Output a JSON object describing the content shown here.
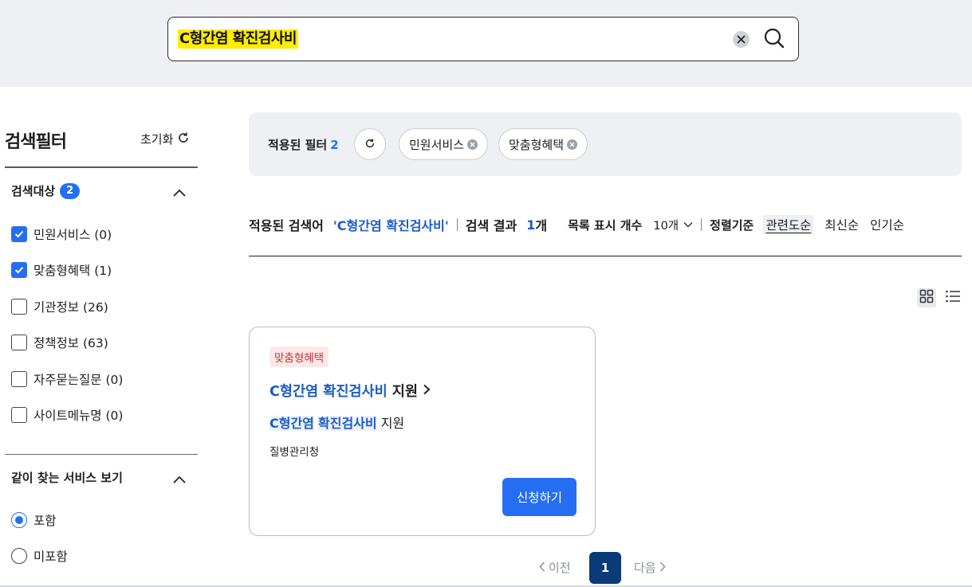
{
  "search": {
    "value": "C형간염 확진검사비"
  },
  "sidebar": {
    "title": "검색필터",
    "reset_label": "초기화",
    "section_target": {
      "title": "검색대상",
      "badge": "2",
      "items": [
        {
          "label": "민원서비스 (0)",
          "checked": true
        },
        {
          "label": "맞춤형혜택 (1)",
          "checked": true
        },
        {
          "label": "기관정보 (26)",
          "checked": false
        },
        {
          "label": "정책정보 (63)",
          "checked": false
        },
        {
          "label": "자주묻는질문 (0)",
          "checked": false
        },
        {
          "label": "사이트메뉴명 (0)",
          "checked": false
        }
      ]
    },
    "section_related": {
      "title": "같이 찾는 서비스 보기",
      "options": [
        {
          "label": "포함",
          "selected": true
        },
        {
          "label": "미포함",
          "selected": false
        }
      ]
    }
  },
  "applied_filters": {
    "label": "적용된 필터",
    "count": "2",
    "chips": [
      "민원서비스",
      "맞춤형혜택"
    ]
  },
  "result_bar": {
    "query_label": "적용된 검색어",
    "query_value": "'C형간염 확진검사비'",
    "result_label": "검색 결과",
    "result_count": "1",
    "result_unit": "개",
    "page_size_label": "목록 표시 개수",
    "page_size_value": "10개",
    "sort_label": "정렬기준",
    "sort_options": [
      "관련도순",
      "최신순",
      "인기순"
    ]
  },
  "results": [
    {
      "tag": "맞춤형혜택",
      "title_keyword": "C형간염 확진검사비",
      "title_rest": "지원",
      "sub_keyword_1": "C형간염",
      "sub_keyword_2": "확진검사비",
      "sub_rest": "지원",
      "org": "질병관리청",
      "apply_label": "신청하기"
    }
  ],
  "pagination": {
    "prev_label": "이전",
    "current": "1",
    "next_label": "다음"
  },
  "colors": {
    "accent": "#256ef4",
    "keyword": "#1a5cc8",
    "highlight": "#ffed00",
    "page_current": "#0b3a78"
  }
}
